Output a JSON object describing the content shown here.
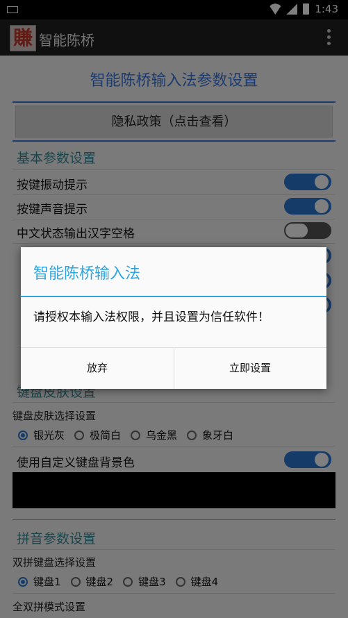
{
  "status_bar": {
    "time": "1:43"
  },
  "app_bar": {
    "logo_char": "賺",
    "title": "智能陈桥"
  },
  "page": {
    "title": "智能陈桥输入法参数设置",
    "privacy_button": "隐私政策（点击查看）"
  },
  "basic": {
    "header": "基本参数设置",
    "items": [
      {
        "label": "按键振动提示",
        "on": true
      },
      {
        "label": "按键声音提示",
        "on": true
      },
      {
        "label": "中文状态输出汉字空格",
        "on": false
      }
    ]
  },
  "skin": {
    "header": "键盘皮肤设置",
    "select_label": "键盘皮肤选择设置",
    "options": [
      "银光灰",
      "极简白",
      "乌金黑",
      "象牙白"
    ],
    "selected": 0,
    "custom_bg_label": "使用自定义键盘背景色"
  },
  "pinyin": {
    "header": "拼音参数设置",
    "select_label": "双拼键盘选择设置",
    "options": [
      "键盘1",
      "键盘2",
      "键盘3",
      "键盘4"
    ],
    "selected": 0,
    "full_mode_label": "全双拼模式设置"
  },
  "dialog": {
    "title": "智能陈桥输入法",
    "message": "请授权本输入法权限，并且设置为信任软件！",
    "cancel": "放弃",
    "confirm": "立即设置"
  },
  "colors": {
    "accent": "#3a76d9",
    "dialog_accent": "#2fa5e0",
    "toggle_on": "#2a76d2"
  }
}
